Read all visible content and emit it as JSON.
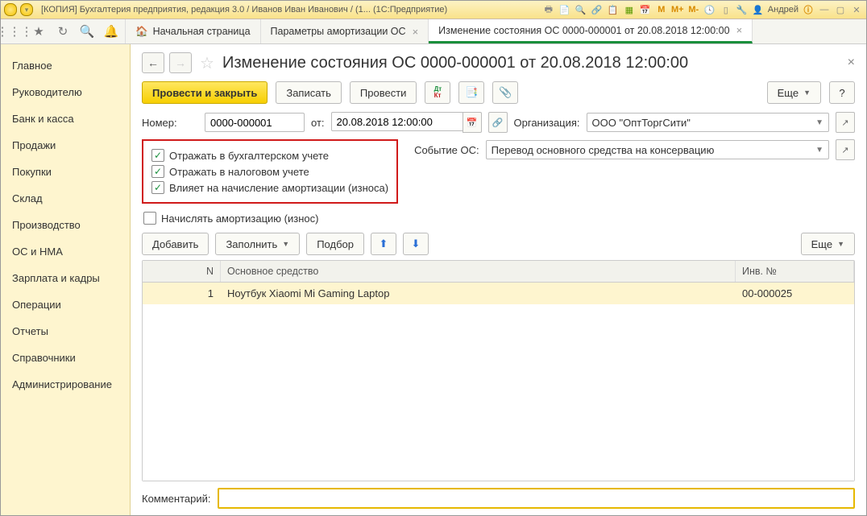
{
  "titlebar": {
    "title": "[КОПИЯ] Бухгалтерия предприятия, редакция 3.0 / Иванов Иван Иванович / (1...  (1С:Предприятие)",
    "user": "Андрей",
    "m_plus": "M+",
    "m": "M",
    "m_minus": "M-"
  },
  "tabs": {
    "home": "Начальная страница",
    "t1": "Параметры амортизации ОС",
    "t2": "Изменение состояния ОС 0000-000001 от 20.08.2018 12:00:00"
  },
  "sidebar": {
    "items": [
      "Главное",
      "Руководителю",
      "Банк и касса",
      "Продажи",
      "Покупки",
      "Склад",
      "Производство",
      "ОС и НМА",
      "Зарплата и кадры",
      "Операции",
      "Отчеты",
      "Справочники",
      "Администрирование"
    ]
  },
  "page": {
    "title": "Изменение состояния ОС 0000-000001 от 20.08.2018 12:00:00"
  },
  "buttons": {
    "post_close": "Провести и закрыть",
    "write": "Записать",
    "post": "Провести",
    "more": "Еще",
    "add": "Добавить",
    "fill": "Заполнить",
    "select": "Подбор"
  },
  "form": {
    "number_lbl": "Номер:",
    "number": "0000-000001",
    "from_lbl": "от:",
    "date": "20.08.2018 12:00:00",
    "org_lbl": "Организация:",
    "org": "ООО \"ОптТоргСити\"",
    "event_lbl": "Событие ОС:",
    "event": "Перевод основного средства на консервацию"
  },
  "checks": {
    "c1": "Отражать в бухгалтерском учете",
    "c2": "Отражать в налоговом учете",
    "c3": "Влияет на начисление амортизации (износа)",
    "c4": "Начислять амортизацию (износ)"
  },
  "table": {
    "col_n": "N",
    "col_os": "Основное средство",
    "col_inv": "Инв. №",
    "rows": [
      {
        "n": "1",
        "os": "Ноутбук Xiaomi Mi Gaming Laptop",
        "inv": "00-000025"
      }
    ]
  },
  "comment_lbl": "Комментарий:"
}
